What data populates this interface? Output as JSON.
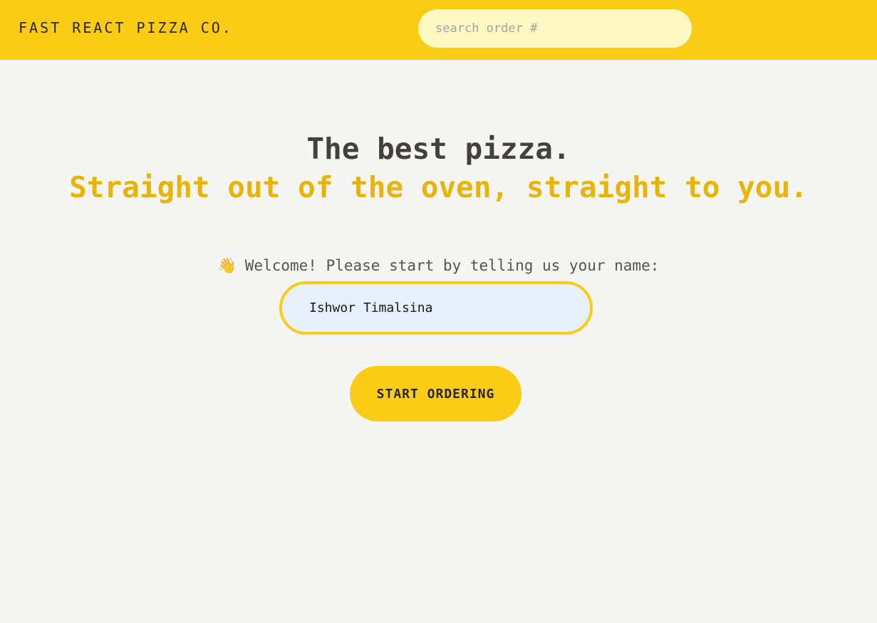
{
  "header": {
    "logo": "FAST REACT PIZZA CO.",
    "search_placeholder": "search order #"
  },
  "hero": {
    "line1": "The best pizza.",
    "line2": "Straight out of the oven, straight to you."
  },
  "welcome": {
    "emoji": "👋",
    "text": "Welcome! Please start by telling us your name:"
  },
  "name_input": {
    "value": "Ishwor Timalsina"
  },
  "start_button": {
    "label": "START ORDERING"
  },
  "colors": {
    "header_bg": "#facc15",
    "page_bg": "#f5f5f4",
    "accent_text": "#eab308",
    "search_bg": "#fef9c3"
  }
}
